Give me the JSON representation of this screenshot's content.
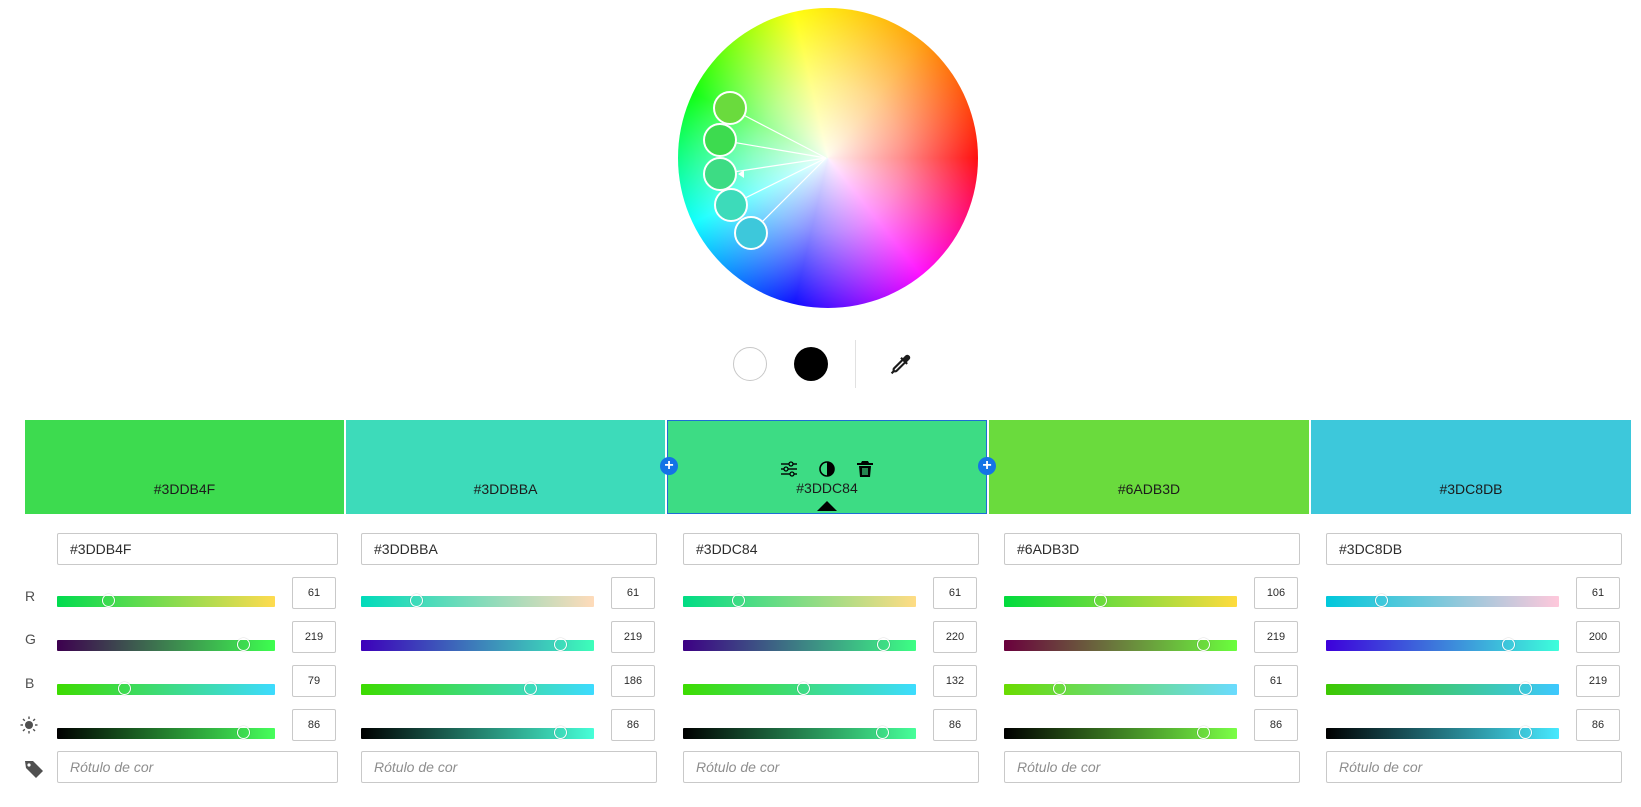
{
  "wheel": {
    "handles": [
      {
        "name": "handle-1",
        "color": "#6ADB3D"
      },
      {
        "name": "handle-2",
        "color": "#3DDB4F"
      },
      {
        "name": "handle-3",
        "color": "#3DDC84"
      },
      {
        "name": "handle-4",
        "color": "#3DDBBA"
      },
      {
        "name": "handle-5",
        "color": "#3DC8DB"
      }
    ]
  },
  "tools": {
    "white_icon": "white-swatch-icon",
    "black_icon": "black-swatch-icon",
    "eyedropper_icon": "eyedropper-icon"
  },
  "rows": {
    "r": "R",
    "g": "G",
    "b": "B",
    "brightness_icon": "brightness-icon",
    "tag_icon": "tag-icon"
  },
  "swatches": [
    {
      "hex": "#3DDB4F",
      "color": "#3DDB4F",
      "r": "61",
      "g": "219",
      "b": "79",
      "br": "86",
      "label_placeholder": "Rótulo de cor",
      "r_val": 61,
      "g_val": 219,
      "b_val": 79,
      "br_val": 86,
      "r_grad": [
        "#00db4f",
        "#ffdb4f"
      ],
      "g_grad": [
        "#3d004f",
        "#3dff4f"
      ],
      "b_grad": [
        "#3ddb00",
        "#3ddbff"
      ],
      "br_grad": [
        "#000000",
        "#47ff5c"
      ]
    },
    {
      "hex": "#3DDBBA",
      "color": "#3DDBBA",
      "r": "61",
      "g": "219",
      "b": "186",
      "br": "86",
      "label_placeholder": "Rótulo de cor",
      "r_val": 61,
      "g_val": 219,
      "b_val": 186,
      "br_val": 86,
      "r_grad": [
        "#00dbba",
        "#ffdbba"
      ],
      "g_grad": [
        "#3d00ba",
        "#3dffba"
      ],
      "b_grad": [
        "#3ddb00",
        "#3ddbff"
      ],
      "br_grad": [
        "#000000",
        "#47ffd8"
      ]
    },
    {
      "hex": "#3DDC84",
      "color": "#3DDC84",
      "r": "61",
      "g": "220",
      "b": "132",
      "br": "86",
      "label_placeholder": "Rótulo de cor",
      "r_val": 61,
      "g_val": 220,
      "b_val": 132,
      "br_val": 86,
      "r_grad": [
        "#00dc84",
        "#ffdc84"
      ],
      "g_grad": [
        "#3d0084",
        "#3dff84"
      ],
      "b_grad": [
        "#3ddc00",
        "#3ddcff"
      ],
      "br_grad": [
        "#000000",
        "#47ff9a"
      ],
      "active": true
    },
    {
      "hex": "#6ADB3D",
      "color": "#6ADB3D",
      "r": "106",
      "g": "219",
      "b": "61",
      "br": "86",
      "label_placeholder": "Rótulo de cor",
      "r_val": 106,
      "g_val": 219,
      "b_val": 61,
      "br_val": 86,
      "r_grad": [
        "#00db3d",
        "#ffdb3d"
      ],
      "g_grad": [
        "#6a003d",
        "#6aff3d"
      ],
      "b_grad": [
        "#6adb00",
        "#6adbff"
      ],
      "br_grad": [
        "#000000",
        "#7bff47"
      ]
    },
    {
      "hex": "#3DC8DB",
      "color": "#3DC8DB",
      "r": "61",
      "g": "200",
      "b": "219",
      "br": "86",
      "label_placeholder": "Rótulo de cor",
      "r_val": 61,
      "g_val": 200,
      "b_val": 219,
      "br_val": 86,
      "r_grad": [
        "#00c8db",
        "#ffc8db"
      ],
      "g_grad": [
        "#3d00db",
        "#3dffdb"
      ],
      "b_grad": [
        "#3dc800",
        "#3dc8ff"
      ],
      "br_grad": [
        "#000000",
        "#47e9ff"
      ]
    }
  ],
  "swatch_tools": {
    "adjust_icon": "sliders-icon",
    "contrast_icon": "contrast-icon",
    "delete_icon": "trash-icon"
  }
}
